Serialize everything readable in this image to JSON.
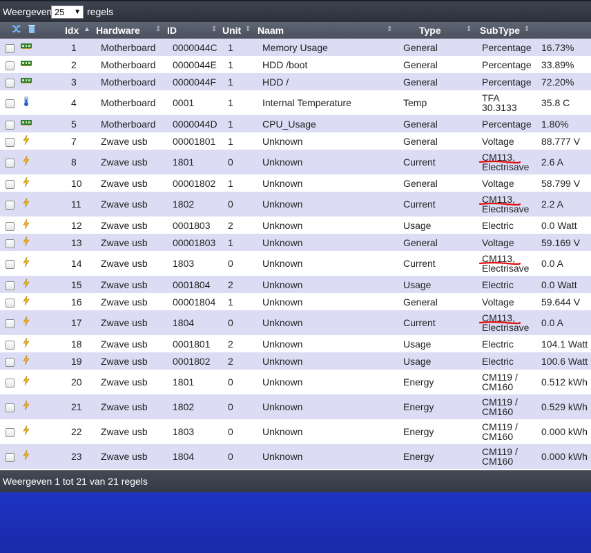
{
  "length_control": {
    "prefix": "Weergeven",
    "value": "25",
    "suffix": "regels"
  },
  "columns": {
    "idx": "Idx",
    "hardware": "Hardware",
    "id": "ID",
    "unit": "Unit",
    "name": "Naam",
    "type": "Type",
    "subtype": "SubType"
  },
  "rows": [
    {
      "idx": "1",
      "hardware": "Motherboard",
      "id": "0000044C",
      "unit": "1",
      "name": "Memory Usage",
      "type": "General",
      "subtype": [
        "Percentage"
      ],
      "value": "16.73%",
      "icon": "motherboard-icon",
      "marked": false
    },
    {
      "idx": "2",
      "hardware": "Motherboard",
      "id": "0000044E",
      "unit": "1",
      "name": "HDD /boot",
      "type": "General",
      "subtype": [
        "Percentage"
      ],
      "value": "33.89%",
      "icon": "motherboard-icon",
      "marked": false
    },
    {
      "idx": "3",
      "hardware": "Motherboard",
      "id": "0000044F",
      "unit": "1",
      "name": "HDD /",
      "type": "General",
      "subtype": [
        "Percentage"
      ],
      "value": "72.20%",
      "icon": "motherboard-icon",
      "marked": false
    },
    {
      "idx": "4",
      "hardware": "Motherboard",
      "id": "0001",
      "unit": "1",
      "name": "Internal Temperature",
      "type": "Temp",
      "subtype": [
        "TFA",
        "30.3133"
      ],
      "value": "35.8 C",
      "icon": "thermometer-icon",
      "marked": false
    },
    {
      "idx": "5",
      "hardware": "Motherboard",
      "id": "0000044D",
      "unit": "1",
      "name": "CPU_Usage",
      "type": "General",
      "subtype": [
        "Percentage"
      ],
      "value": "1.80%",
      "icon": "motherboard-icon",
      "marked": false
    },
    {
      "idx": "7",
      "hardware": "Zwave usb",
      "id": "00001801",
      "unit": "1",
      "name": "Unknown",
      "type": "General",
      "subtype": [
        "Voltage"
      ],
      "value": "88.777 V",
      "icon": "lightning-icon",
      "marked": false
    },
    {
      "idx": "8",
      "hardware": "Zwave usb",
      "id": "1801",
      "unit": "0",
      "name": "Unknown",
      "type": "Current",
      "subtype": [
        "CM113,",
        "Electrisave"
      ],
      "value": "2.6 A",
      "icon": "lightning-icon",
      "marked": true
    },
    {
      "idx": "10",
      "hardware": "Zwave usb",
      "id": "00001802",
      "unit": "1",
      "name": "Unknown",
      "type": "General",
      "subtype": [
        "Voltage"
      ],
      "value": "58.799 V",
      "icon": "lightning-icon",
      "marked": false
    },
    {
      "idx": "11",
      "hardware": "Zwave usb",
      "id": "1802",
      "unit": "0",
      "name": "Unknown",
      "type": "Current",
      "subtype": [
        "CM113,",
        "Electrisave"
      ],
      "value": "2.2 A",
      "icon": "lightning-icon",
      "marked": true
    },
    {
      "idx": "12",
      "hardware": "Zwave usb",
      "id": "0001803",
      "unit": "2",
      "name": "Unknown",
      "type": "Usage",
      "subtype": [
        "Electric"
      ],
      "value": "0.0 Watt",
      "icon": "lightning-icon",
      "marked": false
    },
    {
      "idx": "13",
      "hardware": "Zwave usb",
      "id": "00001803",
      "unit": "1",
      "name": "Unknown",
      "type": "General",
      "subtype": [
        "Voltage"
      ],
      "value": "59.169 V",
      "icon": "lightning-icon",
      "marked": false
    },
    {
      "idx": "14",
      "hardware": "Zwave usb",
      "id": "1803",
      "unit": "0",
      "name": "Unknown",
      "type": "Current",
      "subtype": [
        "CM113,",
        "Electrisave"
      ],
      "value": "0.0 A",
      "icon": "lightning-icon",
      "marked": true
    },
    {
      "idx": "15",
      "hardware": "Zwave usb",
      "id": "0001804",
      "unit": "2",
      "name": "Unknown",
      "type": "Usage",
      "subtype": [
        "Electric"
      ],
      "value": "0.0 Watt",
      "icon": "lightning-icon",
      "marked": false
    },
    {
      "idx": "16",
      "hardware": "Zwave usb",
      "id": "00001804",
      "unit": "1",
      "name": "Unknown",
      "type": "General",
      "subtype": [
        "Voltage"
      ],
      "value": "59.644 V",
      "icon": "lightning-icon",
      "marked": false
    },
    {
      "idx": "17",
      "hardware": "Zwave usb",
      "id": "1804",
      "unit": "0",
      "name": "Unknown",
      "type": "Current",
      "subtype": [
        "CM113,",
        "Electrisave"
      ],
      "value": "0.0 A",
      "icon": "lightning-icon",
      "marked": true
    },
    {
      "idx": "18",
      "hardware": "Zwave usb",
      "id": "0001801",
      "unit": "2",
      "name": "Unknown",
      "type": "Usage",
      "subtype": [
        "Electric"
      ],
      "value": "104.1 Watt",
      "icon": "lightning-icon",
      "marked": false
    },
    {
      "idx": "19",
      "hardware": "Zwave usb",
      "id": "0001802",
      "unit": "2",
      "name": "Unknown",
      "type": "Usage",
      "subtype": [
        "Electric"
      ],
      "value": "100.6 Watt",
      "icon": "lightning-icon",
      "marked": false
    },
    {
      "idx": "20",
      "hardware": "Zwave usb",
      "id": "1801",
      "unit": "0",
      "name": "Unknown",
      "type": "Energy",
      "subtype": [
        "CM119 /",
        "CM160"
      ],
      "value": "0.512 kWh",
      "icon": "lightning-icon",
      "marked": false
    },
    {
      "idx": "21",
      "hardware": "Zwave usb",
      "id": "1802",
      "unit": "0",
      "name": "Unknown",
      "type": "Energy",
      "subtype": [
        "CM119 /",
        "CM160"
      ],
      "value": "0.529 kWh",
      "icon": "lightning-icon",
      "marked": false
    },
    {
      "idx": "22",
      "hardware": "Zwave usb",
      "id": "1803",
      "unit": "0",
      "name": "Unknown",
      "type": "Energy",
      "subtype": [
        "CM119 /",
        "CM160"
      ],
      "value": "0.000 kWh",
      "icon": "lightning-icon",
      "marked": false
    },
    {
      "idx": "23",
      "hardware": "Zwave usb",
      "id": "1804",
      "unit": "0",
      "name": "Unknown",
      "type": "Energy",
      "subtype": [
        "CM119 /",
        "CM160"
      ],
      "value": "0.000 kWh",
      "icon": "lightning-icon",
      "marked": false
    }
  ],
  "footer": {
    "info": "Weergeven 1 tot 21 van 21 regels"
  },
  "colors": {
    "row_alt": "#dcdcf5",
    "row": "#ffffff",
    "header": "#4a505c",
    "background": "#1e33c4",
    "mark": "#e01010"
  }
}
